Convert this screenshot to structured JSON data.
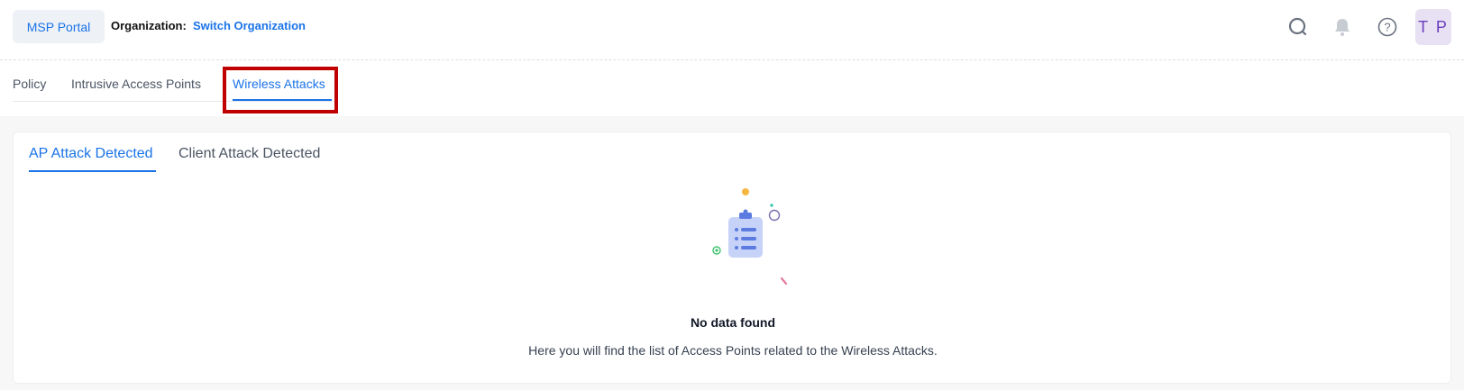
{
  "header": {
    "portal_button": "MSP Portal",
    "org_label": "Organization:",
    "org_link": "Switch Organization",
    "avatar_initials": "T P"
  },
  "tabs": [
    {
      "label": "Policy",
      "active": false
    },
    {
      "label": "Intrusive Access Points",
      "active": false
    },
    {
      "label": "Wireless Attacks",
      "active": true
    }
  ],
  "subtabs": [
    {
      "label": "AP Attack Detected",
      "active": true
    },
    {
      "label": "Client Attack Detected",
      "active": false
    }
  ],
  "empty_state": {
    "title": "No data found",
    "description": "Here you will find the list of Access Points related to the Wireless Attacks."
  },
  "colors": {
    "accent": "#1a73e8",
    "highlight": "#c00000",
    "avatar_bg": "#e8e0f3"
  },
  "icons": [
    "search-icon",
    "bell-icon",
    "help-icon",
    "clipboard-list-icon"
  ]
}
